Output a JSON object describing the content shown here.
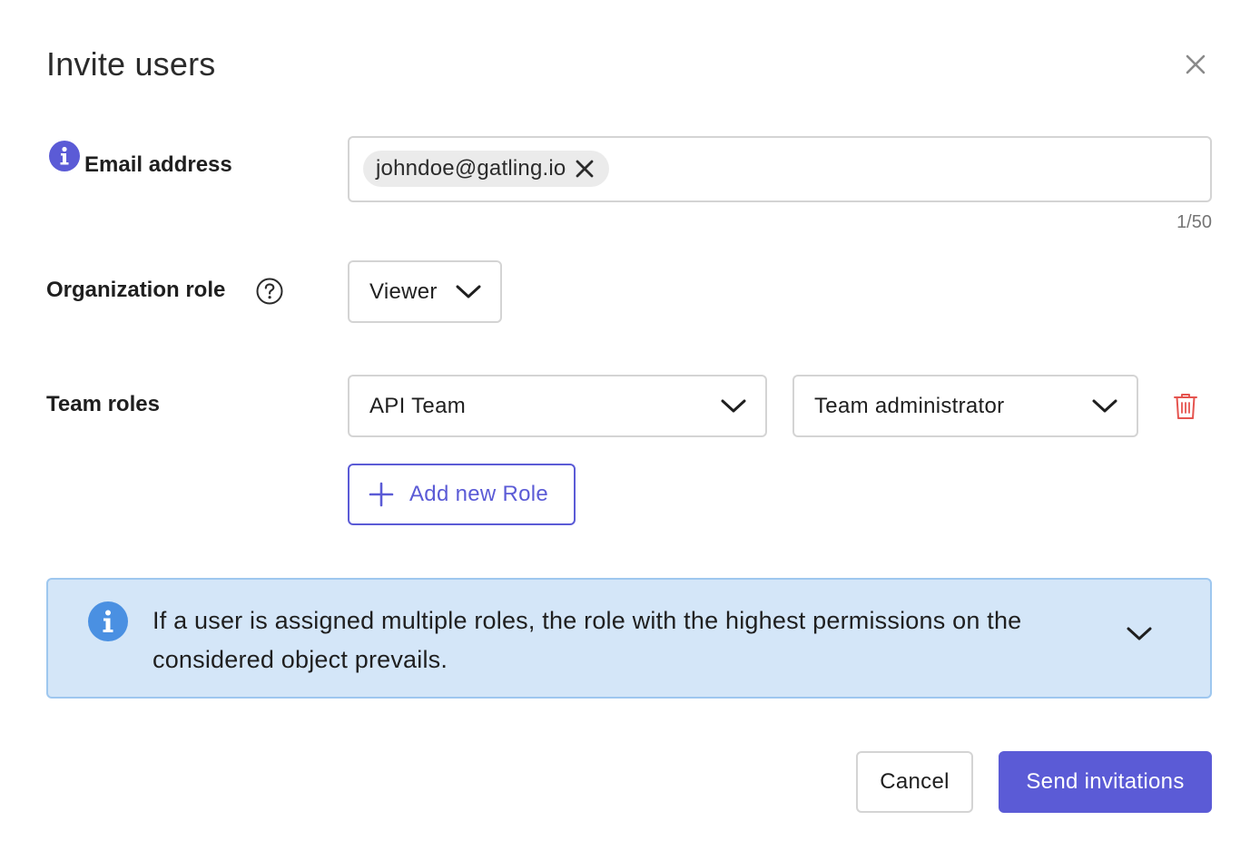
{
  "dialog": {
    "title": "Invite users"
  },
  "email": {
    "label": "Email address",
    "chips": [
      "johndoe@gatling.io"
    ],
    "counter": "1/50"
  },
  "organization": {
    "label": "Organization role",
    "selected": "Viewer"
  },
  "team_roles": {
    "label": "Team roles",
    "team_selected": "API Team",
    "role_selected": "Team administrator",
    "add_label": "Add new Role"
  },
  "notice": {
    "text": "If a user is assigned multiple roles, the role with the highest permissions on the considered object prevails."
  },
  "actions": {
    "cancel_label": "Cancel",
    "send_label": "Send invitations"
  },
  "colors": {
    "accent": "#5b5bd6",
    "danger": "#e5544f",
    "info_bg": "#d4e6f8",
    "info_icon": "#4a90e2"
  },
  "icons": [
    "close-icon",
    "info-icon",
    "help-icon",
    "chevron-down-icon",
    "trash-icon",
    "plus-icon"
  ]
}
